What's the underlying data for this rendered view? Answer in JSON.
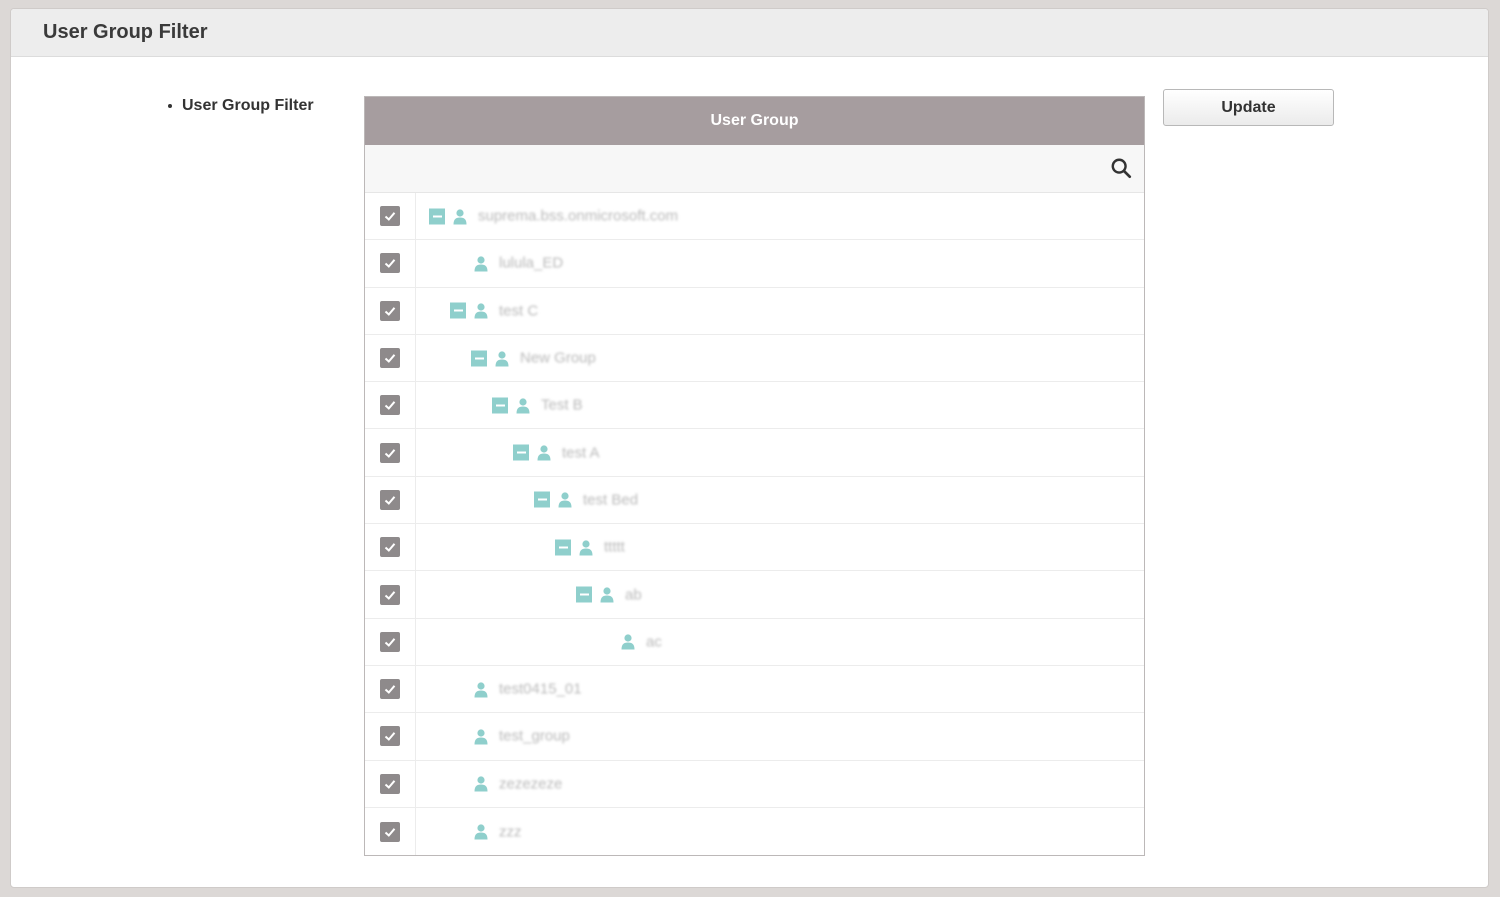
{
  "panel": {
    "title": "User Group Filter"
  },
  "form": {
    "field_label": "User Group Filter",
    "update_label": "Update"
  },
  "tree": {
    "header": "User Group",
    "search_icon": "search-icon",
    "colors": {
      "header_bg": "#a69d9f",
      "checkbox": "#8e8a8b",
      "icon_teal": "#8fcfcc"
    },
    "nodes": [
      {
        "name": "suprema.bss.onmicrosoft.com",
        "depth": 0,
        "expandable": true,
        "checked": true
      },
      {
        "name": "lulula_ED",
        "depth": 1,
        "expandable": false,
        "checked": true
      },
      {
        "name": "test C",
        "depth": 1,
        "expandable": true,
        "checked": true
      },
      {
        "name": "New Group",
        "depth": 2,
        "expandable": true,
        "checked": true
      },
      {
        "name": "Test B",
        "depth": 3,
        "expandable": true,
        "checked": true
      },
      {
        "name": "test A",
        "depth": 4,
        "expandable": true,
        "checked": true
      },
      {
        "name": "test Bed",
        "depth": 5,
        "expandable": true,
        "checked": true
      },
      {
        "name": "ttttt",
        "depth": 6,
        "expandable": true,
        "checked": true
      },
      {
        "name": "ab",
        "depth": 7,
        "expandable": true,
        "checked": true
      },
      {
        "name": "ac",
        "depth": 8,
        "expandable": false,
        "checked": true
      },
      {
        "name": "test0415_01",
        "depth": 1,
        "expandable": false,
        "checked": true
      },
      {
        "name": "test_group",
        "depth": 1,
        "expandable": false,
        "checked": true
      },
      {
        "name": "zezezeze",
        "depth": 1,
        "expandable": false,
        "checked": true
      },
      {
        "name": "zzz",
        "depth": 1,
        "expandable": false,
        "checked": true
      }
    ]
  }
}
